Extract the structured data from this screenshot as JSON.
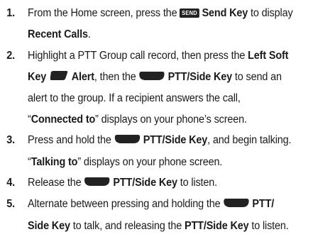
{
  "steps": [
    {
      "num": "1.",
      "t1": "From the Home screen, press the ",
      "send_icon_text": "SEND",
      "t2_bold": "Send Key",
      "t3": " to display",
      "t4_bold": "Recent Calls",
      "t5": "."
    },
    {
      "num": "2.",
      "t1": "Highlight a PTT Group call record, then press the ",
      "t2_bold": "Left Soft",
      "t3_bold": "Key",
      "t4_bold": "Alert",
      "t5": ", then the ",
      "t6_bold": "PTT/Side Key",
      "t7": " to send an",
      "t8": "alert to the group. If a recipient answers the call,",
      "t9": "“",
      "t10_bold": "Connected to",
      "t11": "” displays on your phone’s screen."
    },
    {
      "num": "3.",
      "t1": "Press and hold the ",
      "t2_bold": "PTT/Side Key",
      "t3": ", and begin talking.",
      "t4": "“",
      "t5_bold": "Talking to",
      "t6": "” displays on your phone screen."
    },
    {
      "num": "4.",
      "t1": "Release the ",
      "t2_bold": "PTT/Side Key",
      "t3": " to listen."
    },
    {
      "num": "5.",
      "t1": "Alternate between pressing and holding the ",
      "t2_bold": "PTT/",
      "t3_bold": "Side Key",
      "t4": " to talk, and releasing the ",
      "t5_bold": "PTT/Side Key",
      "t6": " to listen."
    }
  ],
  "icons": {
    "send": "send-key-icon",
    "left_soft": "left-soft-key-icon",
    "ptt": "ptt-side-key-icon"
  }
}
